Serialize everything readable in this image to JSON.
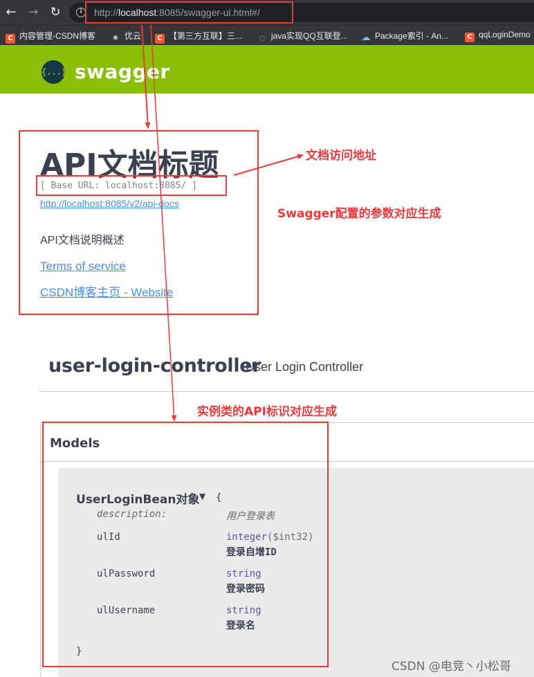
{
  "browser": {
    "url_prefix": "http://",
    "url_host": "localhost",
    "url_rest": ":8085/swagger-ui.html#/",
    "bookmarks": [
      {
        "icon": "csdn-icon",
        "label": "内容管理-CSDN博客"
      },
      {
        "icon": "youyun-icon",
        "label": "优云"
      },
      {
        "icon": "csdn-icon",
        "label": "【第三方互联】三..."
      },
      {
        "icon": "github-icon",
        "label": "java实现QQ互联登..."
      },
      {
        "icon": "cloud-icon",
        "label": "Package索引 - An..."
      },
      {
        "icon": "csdn-icon",
        "label": "qqLoginDemo"
      }
    ]
  },
  "swagger": {
    "logo_text": "swagger",
    "logo_icon_text": "{...}",
    "brand_color": "#89bf04"
  },
  "info": {
    "title": "API文档标题",
    "base_url": "[ Base URL: localhost:8085/ ]",
    "api_docs_url": "http://localhost:8085/v2/api-docs",
    "description": "API文档说明概述",
    "terms_label": "Terms of service",
    "website_label": "CSDN博客主页 - Website"
  },
  "controller": {
    "name": "user-login-controller",
    "description": "User Login Controller"
  },
  "models": {
    "title": "Models",
    "model": {
      "name": "UserLoginBean对象",
      "open_brace": "{",
      "close_brace": "}",
      "description_key": "description:",
      "description_value": "用户登录表",
      "properties": [
        {
          "name": "ulId",
          "type": "integer",
          "format": "($int32)",
          "description": "登录自增ID"
        },
        {
          "name": "ulPassword",
          "type": "string",
          "format": "",
          "description": "登录密码"
        },
        {
          "name": "ulUsername",
          "type": "string",
          "format": "",
          "description": "登录名"
        }
      ]
    }
  },
  "annotations": {
    "doc_address": "文档访问地址",
    "swagger_config": "Swagger配置的参数对应生成",
    "api_identifier": "实例类的API标识对应生成",
    "color": "#e93b3b"
  },
  "watermark": "CSDN @电竞丶小松哥"
}
